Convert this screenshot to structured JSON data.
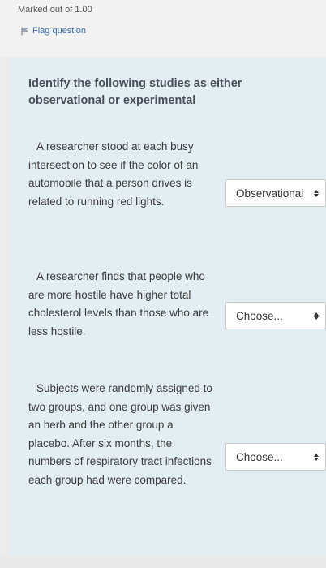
{
  "info": {
    "marked_text": "Marked out of 1.00",
    "flag_label": "Flag question"
  },
  "question": {
    "title": "Identify the following studies as either observational or experimental",
    "items": [
      {
        "text": "A researcher stood at each busy intersection to see if the color of an automobile that a person drives is related to running red lights.",
        "selected": "Observational"
      },
      {
        "text": "A researcher finds that people who are more hostile have higher total cholesterol levels than those who are less hostile.",
        "selected": "Choose..."
      },
      {
        "text": "Subjects were randomly assigned to two groups, and one group was given an herb and the other group a placebo. After six months, the numbers of respiratory tract infections each group had were compared.",
        "selected": "Choose..."
      }
    ]
  },
  "icons": {
    "flag": "flag-icon",
    "select_arrows": "up-down-arrows-icon"
  },
  "colors": {
    "panel_bg": "#e3eef2",
    "flag_link": "#3a6fb0"
  }
}
